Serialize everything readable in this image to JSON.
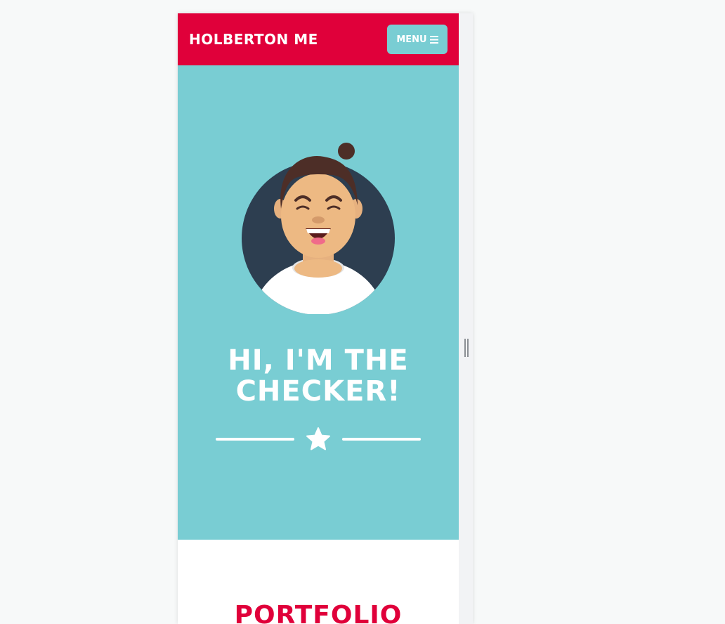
{
  "navbar": {
    "brand": "HOLBERTON ME",
    "menu_label": "MENU",
    "menu_icon": "hamburger-icon"
  },
  "hero": {
    "title_line1": "HI, I'M THE",
    "title_line2": "CHECKER!",
    "avatar_icon": "avatar-illustration",
    "divider_icon": "star-icon"
  },
  "portfolio": {
    "title": "PORTFOLIO"
  },
  "colors": {
    "primary": "#e0003a",
    "accent": "#79cdd3",
    "background": "#f7f9f9"
  }
}
